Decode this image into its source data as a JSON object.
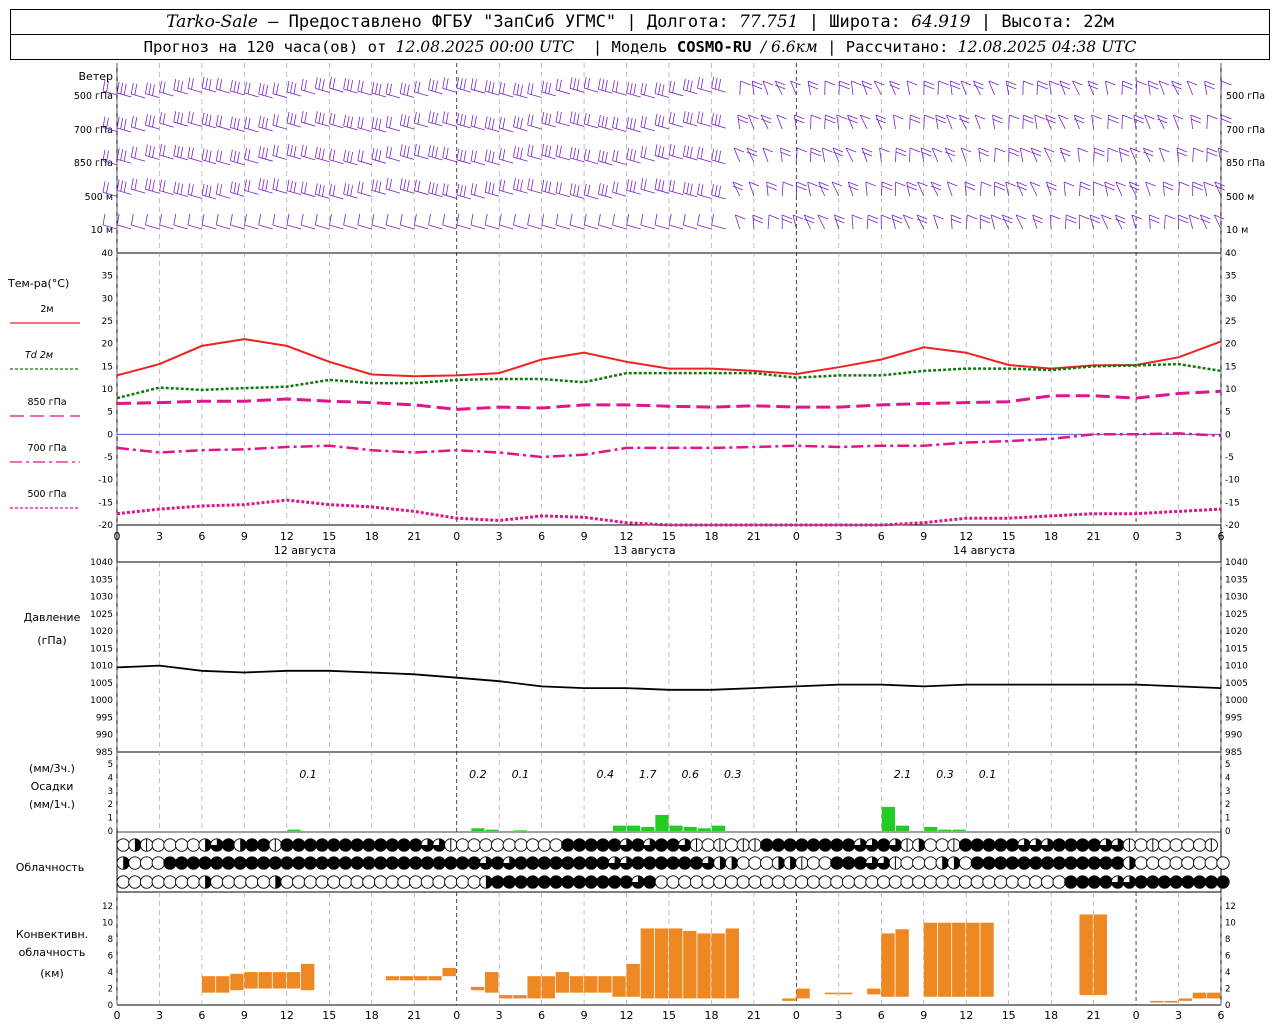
{
  "header": {
    "station": "Tarko-Sale",
    "provider": "– Предоставлено ФГБУ \"ЗапСиб УГМС\"",
    "lon_label": "| Долгота:",
    "lon_value": "77.751",
    "lat_label": "| Широта:",
    "lat_value": "64.919",
    "alt_label": "| Высота: 22м",
    "forecast_label": "Прогноз на 120 часа(ов) от",
    "run_time": "12.08.2025 00:00 UTC",
    "model_label": "| Модель",
    "model_name": "COSMO-RU",
    "resolution": "/ 6.6км",
    "calc_label": "| Рассчитано:",
    "calc_time": "12.08.2025 04:38 UTC"
  },
  "colors": {
    "t2m": "#ee2222",
    "td2m": "#117711",
    "t850": "#e0148c",
    "wind": "#7722cc",
    "pressure": "#000000",
    "precip": "#22cc22",
    "convective": "#ee8822"
  },
  "chart_data": [
    {
      "panel": "wind",
      "type": "wind-barbs",
      "title": "Ветер",
      "levels": [
        "500 гПа",
        "700 гПа",
        "850 гПа",
        "500 м",
        "10 м"
      ],
      "x_ticks": [
        "0",
        "3",
        "6",
        "9",
        "12",
        "15",
        "18",
        "21",
        "0",
        "3",
        "6",
        "9",
        "12",
        "15",
        "18",
        "21",
        "0",
        "3",
        "6",
        "9",
        "12",
        "15",
        "18",
        "21",
        "0",
        "3",
        "6"
      ],
      "first_period_direction": "west",
      "second_period_direction": "south"
    },
    {
      "panel": "temperature",
      "type": "line",
      "ylabel": "Тем-ра(°C)",
      "ylim": [
        -20,
        40
      ],
      "yticks": [
        "40",
        "35",
        "30",
        "25",
        "20",
        "15",
        "10",
        "5",
        "0",
        "-5",
        "-10",
        "-15",
        "-20"
      ],
      "x_hours": [
        0,
        3,
        6,
        9,
        12,
        15,
        18,
        21,
        24,
        27,
        30,
        33,
        36,
        39,
        42,
        45,
        48,
        51,
        54,
        57,
        60,
        63,
        66,
        69,
        72,
        75,
        78
      ],
      "x_ticks": [
        "0",
        "3",
        "6",
        "9",
        "12",
        "15",
        "18",
        "21",
        "0",
        "3",
        "6",
        "9",
        "12",
        "15",
        "18",
        "21",
        "0",
        "3",
        "6",
        "9",
        "12",
        "15",
        "18",
        "21",
        "0",
        "3",
        "6"
      ],
      "day_labels": [
        "12 августа",
        "13 августа",
        "14 августа"
      ],
      "series": [
        {
          "name": "2м",
          "values": [
            13,
            15.5,
            19.5,
            21,
            19.5,
            16,
            13.2,
            12.8,
            13,
            13.5,
            16.5,
            18,
            16,
            14.5,
            14.5,
            14,
            13.3,
            14.8,
            16.5,
            19.2,
            18,
            15.3,
            14.5,
            15.2,
            15.3,
            17,
            20.5
          ]
        },
        {
          "name": "Td 2м",
          "values": [
            8,
            10.3,
            9.8,
            10.2,
            10.5,
            12,
            11.3,
            11.3,
            12,
            12.2,
            12.2,
            11.5,
            13.5,
            13.5,
            13.5,
            13.5,
            12.5,
            13,
            13,
            14,
            14.5,
            14.5,
            14.2,
            15,
            15.2,
            15.5,
            14
          ]
        },
        {
          "name": "850 гПа",
          "values": [
            6.8,
            7,
            7.3,
            7.3,
            7.8,
            7.3,
            7,
            6.5,
            5.5,
            6,
            5.8,
            6.5,
            6.5,
            6.2,
            6,
            6.3,
            6,
            6,
            6.5,
            6.8,
            7,
            7.2,
            8.5,
            8.5,
            8,
            9,
            9.5
          ]
        },
        {
          "name": "700 гПа",
          "values": [
            -3,
            -4,
            -3.5,
            -3.3,
            -2.8,
            -2.5,
            -3.5,
            -4,
            -3.5,
            -4,
            -5,
            -4.5,
            -3,
            -3,
            -3,
            -2.8,
            -2.5,
            -2.8,
            -2.5,
            -2.5,
            -1.8,
            -1.5,
            -1,
            0,
            0,
            0.2,
            -0.3
          ]
        },
        {
          "name": "500 гПа",
          "values": [
            -17.5,
            -16.5,
            -15.8,
            -15.5,
            -14.5,
            -15.5,
            -16,
            -17,
            -18.5,
            -19,
            -18,
            -18.3,
            -19.5,
            -20.5,
            -21,
            -21,
            -20,
            -21,
            -21,
            -19.5,
            -18.5,
            -18.5,
            -18,
            -17.5,
            -17.5,
            -17,
            -16.5
          ]
        }
      ]
    },
    {
      "panel": "pressure",
      "type": "line",
      "ylabel": "Давление",
      "yunit": "(гПа)",
      "ylim": [
        985,
        1040
      ],
      "yticks": [
        "1040",
        "1035",
        "1030",
        "1025",
        "1020",
        "1015",
        "1010",
        "1005",
        "1000",
        "995",
        "990",
        "985"
      ],
      "x_hours": [
        0,
        3,
        6,
        9,
        12,
        15,
        18,
        21,
        24,
        27,
        30,
        33,
        36,
        39,
        42,
        45,
        48,
        51,
        54,
        57,
        60,
        63,
        66,
        69,
        72,
        75,
        78
      ],
      "series": [
        {
          "name": "pressure",
          "values": [
            1009.5,
            1010,
            1008.5,
            1008,
            1008.5,
            1008.5,
            1008,
            1007.5,
            1006.5,
            1005.5,
            1004,
            1003.5,
            1003.5,
            1003,
            1003,
            1003.5,
            1004,
            1004.5,
            1004.5,
            1004,
            1004.5,
            1004.5,
            1004.5,
            1004.5,
            1004.5,
            1004,
            1003.5
          ]
        }
      ]
    },
    {
      "panel": "precipitation",
      "type": "bar",
      "ylabel": "(мм/3ч.)",
      "ylabel2": "Осадки",
      "ylabel3": "(мм/1ч.)",
      "ylim": [
        0,
        5
      ],
      "yticks": [
        "5",
        "4",
        "3",
        "2",
        "1",
        "0"
      ],
      "totals_3h": [
        {
          "hour": 13.5,
          "label": "0.1"
        },
        {
          "hour": 25.5,
          "label": "0.2"
        },
        {
          "hour": 28.5,
          "label": "0.1"
        },
        {
          "hour": 34.5,
          "label": "0.4"
        },
        {
          "hour": 37.5,
          "label": "1.7"
        },
        {
          "hour": 40.5,
          "label": "0.6"
        },
        {
          "hour": 43.5,
          "label": "0.3"
        },
        {
          "hour": 55.5,
          "label": "2.1"
        },
        {
          "hour": 58.5,
          "label": "0.3"
        },
        {
          "hour": 61.5,
          "label": "0.1"
        }
      ],
      "hourly": [
        {
          "hour": 12,
          "value": 0.1
        },
        {
          "hour": 25,
          "value": 0.2
        },
        {
          "hour": 26,
          "value": 0.1
        },
        {
          "hour": 28,
          "value": 0.05
        },
        {
          "hour": 35,
          "value": 0.4
        },
        {
          "hour": 36,
          "value": 0.4
        },
        {
          "hour": 37,
          "value": 0.3
        },
        {
          "hour": 38,
          "value": 1.2
        },
        {
          "hour": 39,
          "value": 0.4
        },
        {
          "hour": 40,
          "value": 0.3
        },
        {
          "hour": 41,
          "value": 0.2
        },
        {
          "hour": 42,
          "value": 0.4
        },
        {
          "hour": 54,
          "value": 1.8
        },
        {
          "hour": 55,
          "value": 0.4
        },
        {
          "hour": 57,
          "value": 0.3
        },
        {
          "hour": 58,
          "value": 0.1
        },
        {
          "hour": 59,
          "value": 0.1
        }
      ]
    },
    {
      "panel": "cloudiness",
      "type": "table",
      "ylabel": "Облачность",
      "rows": [
        [
          0,
          2,
          1,
          0,
          0,
          0,
          0,
          2,
          3,
          4,
          2,
          4,
          4,
          1,
          4,
          4,
          4,
          4,
          4,
          4,
          4,
          4,
          4,
          4,
          4,
          4,
          3,
          3,
          1,
          0,
          0,
          0,
          0,
          0,
          0,
          0,
          0,
          0,
          4,
          4,
          4,
          4,
          4,
          3,
          4,
          3,
          4,
          4,
          3,
          1,
          0,
          1,
          0,
          1,
          1,
          4,
          4,
          4,
          4,
          4,
          4,
          4,
          4,
          3,
          3,
          4,
          3,
          1,
          2,
          0,
          0,
          1,
          4,
          4,
          4,
          4,
          4,
          3,
          3,
          3,
          4,
          4,
          4,
          4,
          3,
          3,
          1,
          0,
          1,
          0,
          0,
          0,
          0,
          1
        ],
        [
          2,
          0,
          0,
          0,
          4,
          4,
          4,
          4,
          4,
          4,
          4,
          4,
          4,
          4,
          4,
          4,
          4,
          4,
          4,
          4,
          4,
          4,
          4,
          4,
          4,
          4,
          4,
          4,
          4,
          4,
          4,
          3,
          4,
          3,
          4,
          4,
          4,
          4,
          4,
          4,
          4,
          4,
          3,
          3,
          4,
          4,
          4,
          4,
          4,
          4,
          3,
          2,
          2,
          0,
          0,
          0,
          2,
          2,
          1,
          0,
          0,
          4,
          4,
          4,
          3,
          3,
          1,
          0,
          0,
          0,
          2,
          2,
          0,
          4,
          4,
          4,
          4,
          4,
          4,
          4,
          4,
          4,
          4,
          4,
          4,
          4,
          2,
          0,
          0,
          0,
          0,
          0,
          0,
          0,
          0
        ],
        [
          0,
          0,
          0,
          0,
          0,
          0,
          0,
          2,
          0,
          0,
          0,
          0,
          0,
          2,
          0,
          0,
          0,
          0,
          0,
          0,
          0,
          0,
          0,
          0,
          0,
          0,
          0,
          0,
          0,
          0,
          0,
          2,
          4,
          4,
          4,
          4,
          4,
          4,
          4,
          4,
          4,
          4,
          4,
          4,
          3,
          4,
          0,
          0,
          0,
          0,
          0,
          0,
          0,
          0,
          0,
          0,
          0,
          0,
          0,
          0,
          0,
          0,
          0,
          0,
          0,
          0,
          0,
          0,
          0,
          0,
          0,
          0,
          0,
          0,
          0,
          0,
          0,
          0,
          0,
          0,
          0,
          4,
          4,
          4,
          4,
          3,
          3,
          4,
          4,
          4,
          4,
          4,
          4,
          4,
          4
        ]
      ]
    },
    {
      "panel": "convective",
      "type": "bar",
      "ylabel": "Конвективн.",
      "ylabel2": "облачность",
      "yunit": "(км)",
      "ylim": [
        0,
        13
      ],
      "yticks": [
        "12",
        "10",
        "8",
        "6",
        "4",
        "2",
        "0"
      ],
      "bars": [
        {
          "hour": 6.5,
          "base": 1.5,
          "top": 3.5
        },
        {
          "hour": 7.5,
          "base": 1.5,
          "top": 3.5
        },
        {
          "hour": 8.5,
          "base": 1.8,
          "top": 3.8
        },
        {
          "hour": 9.5,
          "base": 2,
          "top": 4
        },
        {
          "hour": 10.5,
          "base": 2,
          "top": 4
        },
        {
          "hour": 11.5,
          "base": 2,
          "top": 4
        },
        {
          "hour": 12.5,
          "base": 2,
          "top": 4
        },
        {
          "hour": 13.5,
          "base": 1.8,
          "top": 5
        },
        {
          "hour": 19.5,
          "base": 3,
          "top": 3.5
        },
        {
          "hour": 20.5,
          "base": 3,
          "top": 3.5
        },
        {
          "hour": 21.5,
          "base": 3,
          "top": 3.5
        },
        {
          "hour": 22.5,
          "base": 3,
          "top": 3.5
        },
        {
          "hour": 23.5,
          "base": 3.5,
          "top": 4.5
        },
        {
          "hour": 25.5,
          "base": 1.8,
          "top": 2.2
        },
        {
          "hour": 26.5,
          "base": 1.5,
          "top": 4
        },
        {
          "hour": 27.5,
          "base": 0.8,
          "top": 1.2
        },
        {
          "hour": 28.5,
          "base": 0.8,
          "top": 1.2
        },
        {
          "hour": 29.5,
          "base": 0.8,
          "top": 3.5
        },
        {
          "hour": 30.5,
          "base": 0.8,
          "top": 3.5
        },
        {
          "hour": 31.5,
          "base": 1.5,
          "top": 4
        },
        {
          "hour": 32.5,
          "base": 1.5,
          "top": 3.5
        },
        {
          "hour": 33.5,
          "base": 1.5,
          "top": 3.5
        },
        {
          "hour": 34.5,
          "base": 1.5,
          "top": 3.5
        },
        {
          "hour": 35.5,
          "base": 1,
          "top": 3.5
        },
        {
          "hour": 36.5,
          "base": 1,
          "top": 5
        },
        {
          "hour": 37.5,
          "base": 0.8,
          "top": 9.3
        },
        {
          "hour": 38.5,
          "base": 0.8,
          "top": 9.3
        },
        {
          "hour": 39.5,
          "base": 0.8,
          "top": 9.3
        },
        {
          "hour": 40.5,
          "base": 0.8,
          "top": 9
        },
        {
          "hour": 41.5,
          "base": 0.8,
          "top": 8.7
        },
        {
          "hour": 42.5,
          "base": 0.8,
          "top": 8.7
        },
        {
          "hour": 43.5,
          "base": 0.8,
          "top": 9.3
        },
        {
          "hour": 47.5,
          "base": 0.5,
          "top": 0.8
        },
        {
          "hour": 48.5,
          "base": 0.8,
          "top": 2
        },
        {
          "hour": 50.5,
          "base": 1.3,
          "top": 1.5
        },
        {
          "hour": 51.5,
          "base": 1.3,
          "top": 1.5
        },
        {
          "hour": 53.5,
          "base": 1.3,
          "top": 2
        },
        {
          "hour": 54.5,
          "base": 1,
          "top": 8.7
        },
        {
          "hour": 55.5,
          "base": 1,
          "top": 9.2
        },
        {
          "hour": 57.5,
          "base": 1,
          "top": 10
        },
        {
          "hour": 58.5,
          "base": 1,
          "top": 10
        },
        {
          "hour": 59.5,
          "base": 1,
          "top": 10
        },
        {
          "hour": 60.5,
          "base": 1,
          "top": 10
        },
        {
          "hour": 61.5,
          "base": 1,
          "top": 10
        },
        {
          "hour": 68.5,
          "base": 1.2,
          "top": 11
        },
        {
          "hour": 69.5,
          "base": 1.2,
          "top": 11
        },
        {
          "hour": 73.5,
          "base": 0.3,
          "top": 0.5
        },
        {
          "hour": 74.5,
          "base": 0.3,
          "top": 0.5
        },
        {
          "hour": 75.5,
          "base": 0.5,
          "top": 0.8
        },
        {
          "hour": 76.5,
          "base": 0.8,
          "top": 1.5
        },
        {
          "hour": 77.5,
          "base": 0.8,
          "top": 1.5
        }
      ]
    }
  ]
}
